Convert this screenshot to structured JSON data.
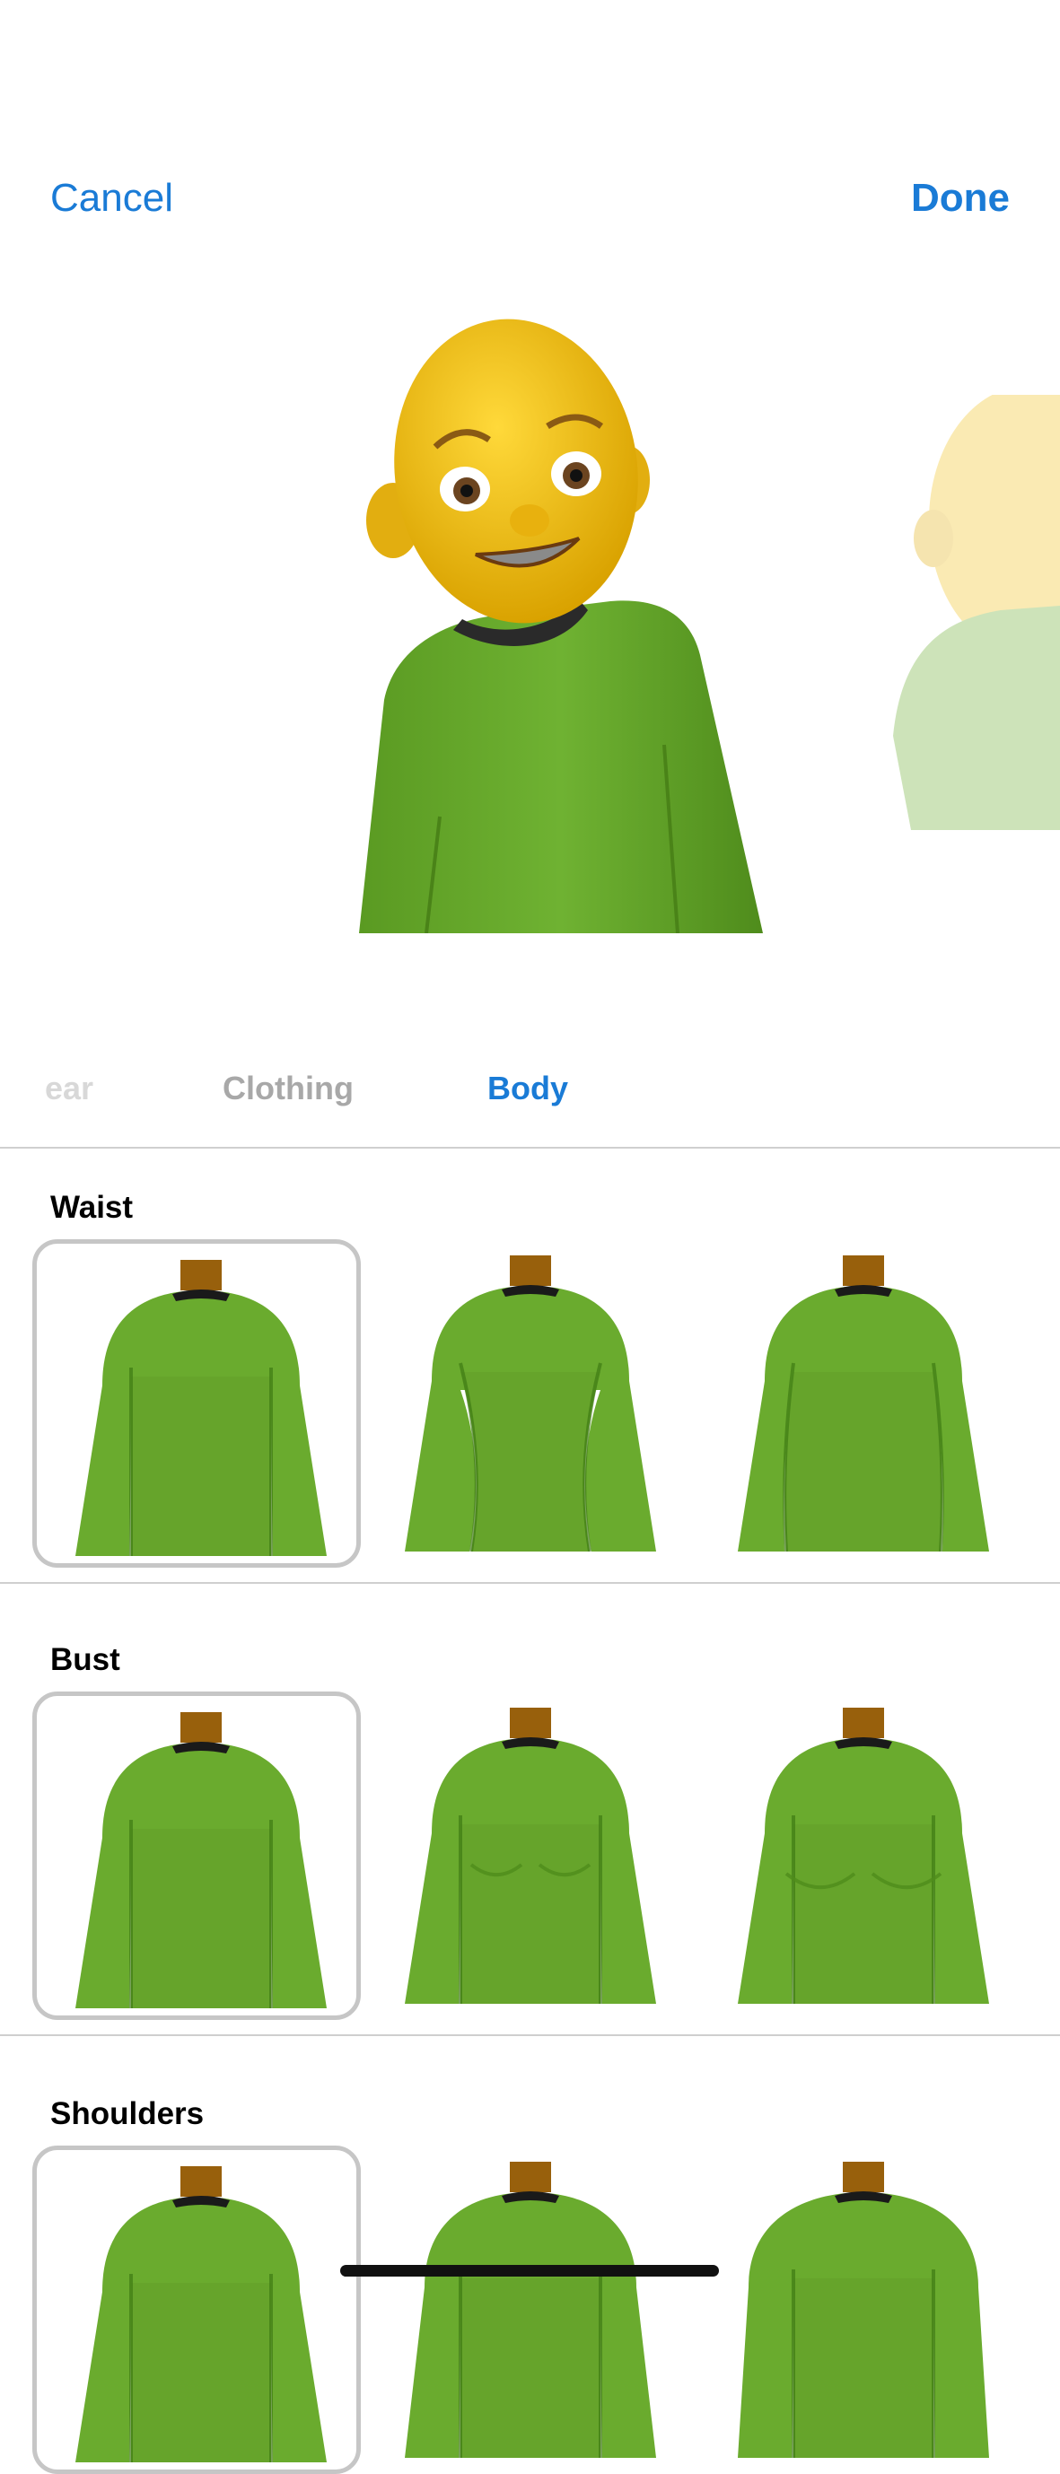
{
  "nav": {
    "cancel_label": "Cancel",
    "done_label": "Done"
  },
  "colors": {
    "accent": "#1a7bd6",
    "shirt": "#6aab2e",
    "skin": "#f2c21b",
    "neck": "#98600c"
  },
  "tabs": [
    {
      "label": "ear",
      "state": "partially-visible"
    },
    {
      "label": "Clothing",
      "state": "inactive"
    },
    {
      "label": "Body",
      "state": "active"
    }
  ],
  "sections": [
    {
      "label": "Waist",
      "selected": 0,
      "options": [
        "straight",
        "narrow",
        "wide"
      ]
    },
    {
      "label": "Bust",
      "selected": 0,
      "options": [
        "flat",
        "small",
        "large"
      ]
    },
    {
      "label": "Shoulders",
      "selected": 0,
      "options": [
        "narrow",
        "medium",
        "broad"
      ]
    }
  ]
}
